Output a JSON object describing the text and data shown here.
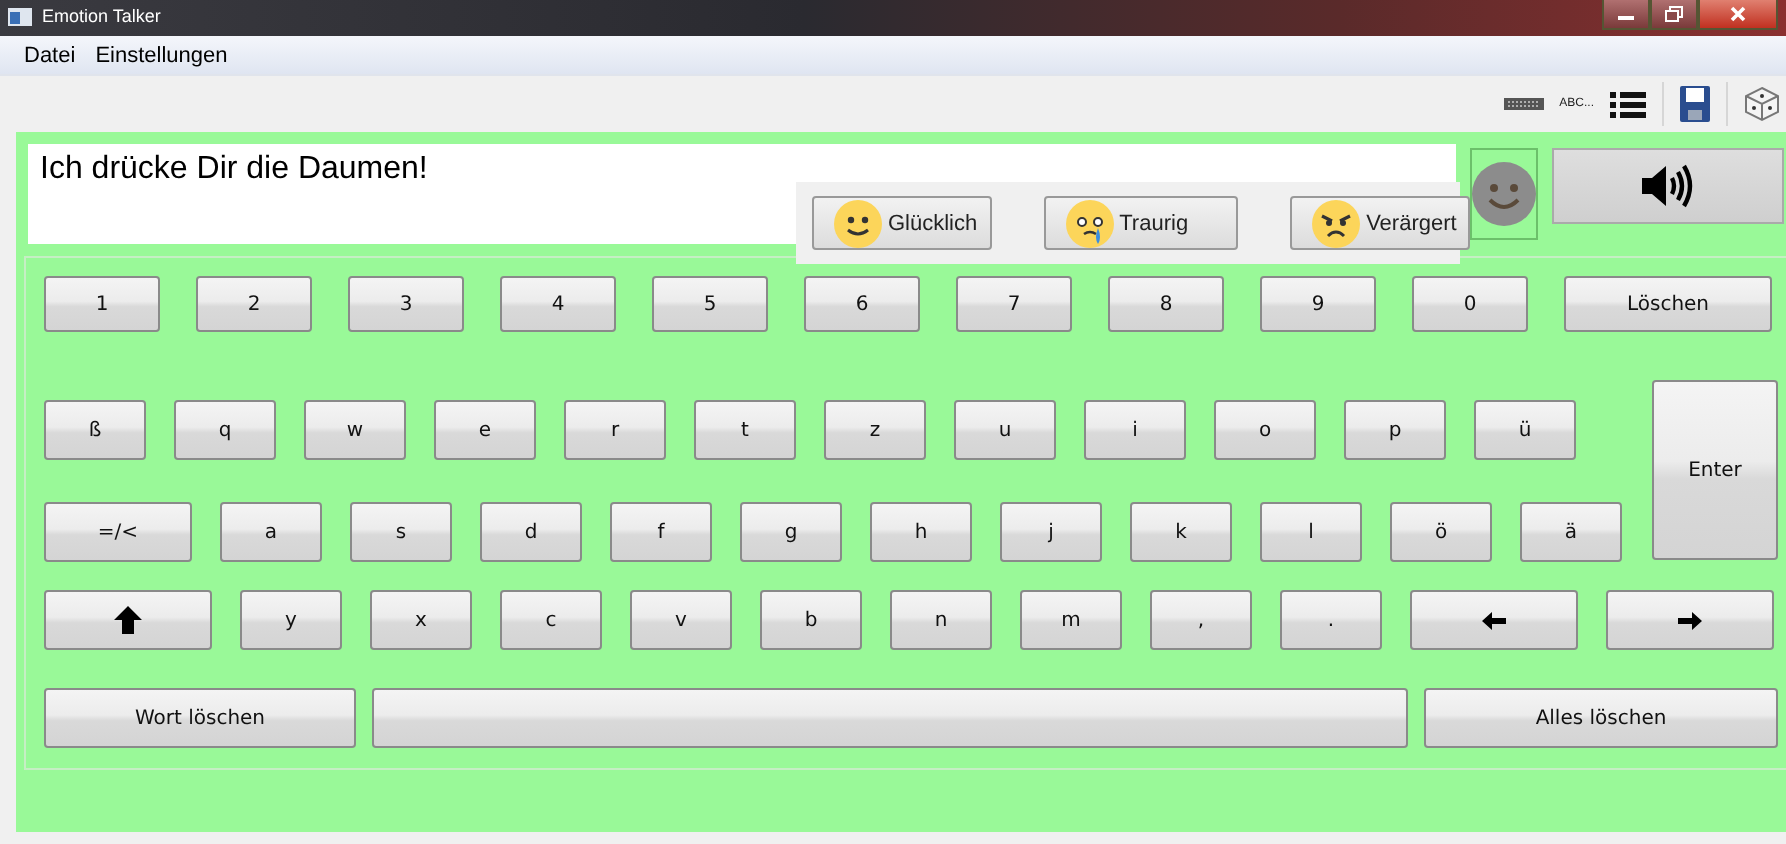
{
  "window": {
    "title": "Emotion Talker"
  },
  "menu": [
    "Datei",
    "Einstellungen"
  ],
  "toolbar": {
    "abc_label": "ABC..."
  },
  "message": {
    "value": "Ich drücke Dir die Daumen!"
  },
  "emotions": [
    {
      "label": "Glücklich",
      "kind": "happy"
    },
    {
      "label": "Traurig",
      "kind": "sad"
    },
    {
      "label": "Verärgert",
      "kind": "angry"
    }
  ],
  "keyboard": {
    "rows": [
      [
        {
          "label": "1",
          "kind": "char"
        },
        {
          "label": "2",
          "kind": "char"
        },
        {
          "label": "3",
          "kind": "char"
        },
        {
          "label": "4",
          "kind": "char"
        },
        {
          "label": "5",
          "kind": "char"
        },
        {
          "label": "6",
          "kind": "char"
        },
        {
          "label": "7",
          "kind": "char"
        },
        {
          "label": "8",
          "kind": "char"
        },
        {
          "label": "9",
          "kind": "char"
        },
        {
          "label": "0",
          "kind": "char"
        },
        {
          "label": "Löschen",
          "kind": "function"
        }
      ],
      [
        {
          "label": "ß",
          "kind": "char"
        },
        {
          "label": "q",
          "kind": "char"
        },
        {
          "label": "w",
          "kind": "char"
        },
        {
          "label": "e",
          "kind": "char"
        },
        {
          "label": "r",
          "kind": "char"
        },
        {
          "label": "t",
          "kind": "char"
        },
        {
          "label": "z",
          "kind": "char"
        },
        {
          "label": "u",
          "kind": "char"
        },
        {
          "label": "i",
          "kind": "char"
        },
        {
          "label": "o",
          "kind": "char"
        },
        {
          "label": "p",
          "kind": "char"
        },
        {
          "label": "ü",
          "kind": "char"
        }
      ],
      [
        {
          "label": "=/<",
          "kind": "function"
        },
        {
          "label": "a",
          "kind": "char"
        },
        {
          "label": "s",
          "kind": "char"
        },
        {
          "label": "d",
          "kind": "char"
        },
        {
          "label": "f",
          "kind": "char"
        },
        {
          "label": "g",
          "kind": "char"
        },
        {
          "label": "h",
          "kind": "char"
        },
        {
          "label": "j",
          "kind": "char"
        },
        {
          "label": "k",
          "kind": "char"
        },
        {
          "label": "l",
          "kind": "char"
        },
        {
          "label": "ö",
          "kind": "char"
        },
        {
          "label": "ä",
          "kind": "char"
        }
      ],
      [
        {
          "kind": "shift"
        },
        {
          "label": "y",
          "kind": "char"
        },
        {
          "label": "x",
          "kind": "char"
        },
        {
          "label": "c",
          "kind": "char"
        },
        {
          "label": "v",
          "kind": "char"
        },
        {
          "label": "b",
          "kind": "char"
        },
        {
          "label": "n",
          "kind": "char"
        },
        {
          "label": "m",
          "kind": "char"
        },
        {
          "label": ",",
          "kind": "char"
        },
        {
          "label": ".",
          "kind": "char"
        },
        {
          "kind": "left"
        },
        {
          "kind": "right"
        }
      ],
      [
        {
          "label": "Wort löschen",
          "kind": "function"
        },
        {
          "kind": "space"
        },
        {
          "label": "Alles löschen",
          "kind": "function"
        }
      ]
    ],
    "enter": {
      "label": "Enter"
    }
  }
}
